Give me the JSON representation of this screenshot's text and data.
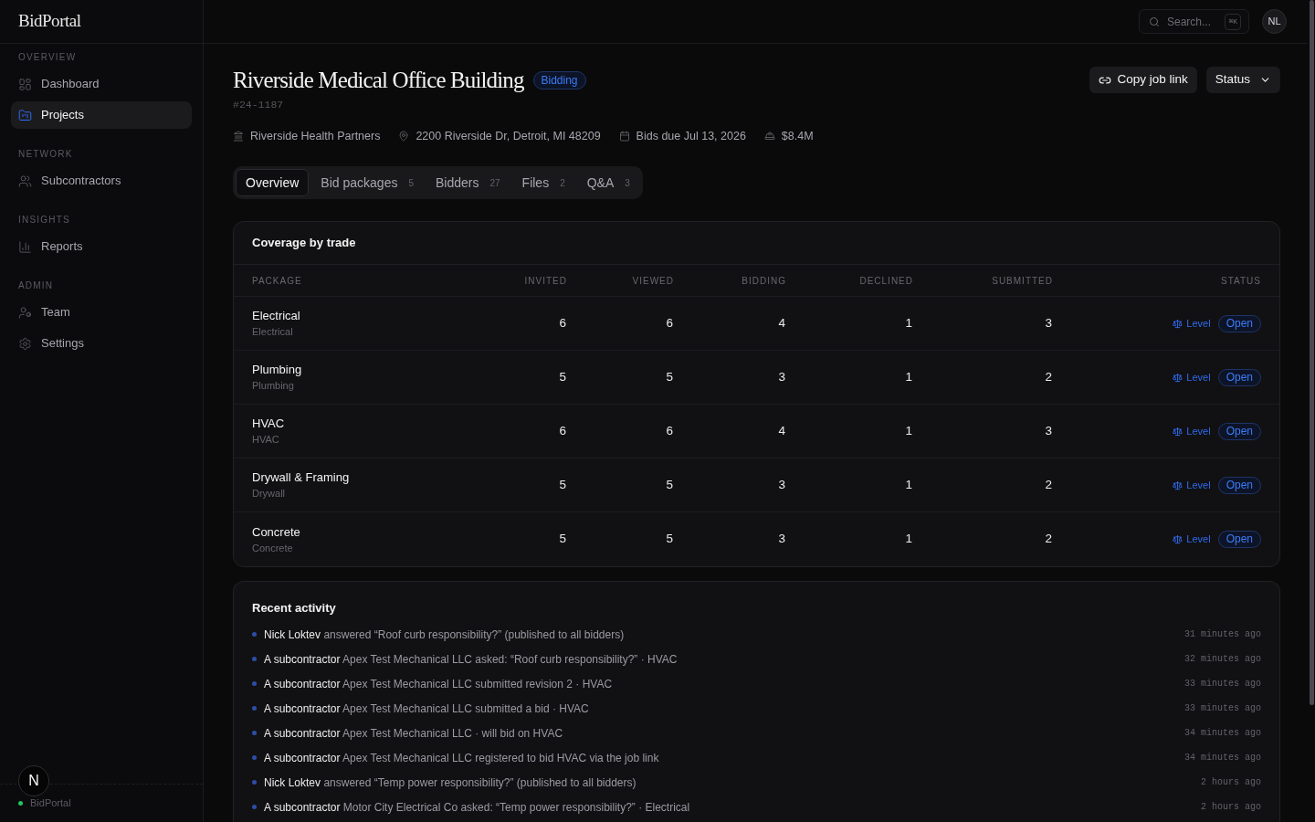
{
  "sidebar": {
    "logo": "BidPortal",
    "sections": [
      {
        "label": "OVERVIEW",
        "items": [
          {
            "label": "Dashboard",
            "selected": false
          },
          {
            "label": "Projects",
            "selected": true
          }
        ]
      },
      {
        "label": "NETWORK",
        "items": [
          {
            "label": "Subcontractors",
            "selected": false
          }
        ]
      },
      {
        "label": "INSIGHTS",
        "items": [
          {
            "label": "Reports",
            "selected": false
          }
        ]
      },
      {
        "label": "ADMIN",
        "items": [
          {
            "label": "Team",
            "selected": false
          },
          {
            "label": "Settings",
            "selected": false
          }
        ]
      }
    ],
    "footer": {
      "label": "BidPortal"
    }
  },
  "dev_badge": {
    "label": "N"
  },
  "top_bar": {
    "search": {
      "placeholder": "Search...",
      "shortcut": "⌘K"
    },
    "avatar": "NL"
  },
  "project": {
    "title": "Riverside Medical Office Building",
    "status": "Bidding",
    "number": "#24-1187",
    "meta": [
      "Riverside Health Partners",
      "2200 Riverside Dr, Detroit, MI 48209",
      "Bids due Jul 13, 2026",
      "$8.4M"
    ],
    "actions": [
      "Copy job link",
      "Status"
    ]
  },
  "tabs": [
    {
      "label": "Overview",
      "selected": true
    },
    {
      "label": "Bid packages",
      "count": "5",
      "selected": false
    },
    {
      "label": "Bidders",
      "count": "27",
      "selected": false
    },
    {
      "label": "Files",
      "count": "2",
      "selected": false
    },
    {
      "label": "Q&A",
      "count": "3",
      "selected": false
    }
  ],
  "coverage": {
    "title": "Coverage by trade",
    "columns": [
      "PACKAGE",
      "INVITED",
      "VIEWED",
      "BIDDING",
      "DECLINED",
      "SUBMITTED",
      "STATUS"
    ],
    "rows": [
      {
        "package": "Electrical",
        "trade": "Electrical",
        "invited": "6",
        "viewed": "6",
        "bidding": "4",
        "declined": "1",
        "submitted": "3",
        "action": "Level",
        "status": "Open"
      },
      {
        "package": "Plumbing",
        "trade": "Plumbing",
        "invited": "5",
        "viewed": "5",
        "bidding": "3",
        "declined": "1",
        "submitted": "2",
        "action": "Level",
        "status": "Open"
      },
      {
        "package": "HVAC",
        "trade": "HVAC",
        "invited": "6",
        "viewed": "6",
        "bidding": "4",
        "declined": "1",
        "submitted": "3",
        "action": "Level",
        "status": "Open"
      },
      {
        "package": "Drywall & Framing",
        "trade": "Drywall",
        "invited": "5",
        "viewed": "5",
        "bidding": "3",
        "declined": "1",
        "submitted": "2",
        "action": "Level",
        "status": "Open"
      },
      {
        "package": "Concrete",
        "trade": "Concrete",
        "invited": "5",
        "viewed": "5",
        "bidding": "3",
        "declined": "1",
        "submitted": "2",
        "action": "Level",
        "status": "Open"
      }
    ]
  },
  "activity": {
    "title": "Recent activity",
    "items": [
      {
        "actor": "Nick Loktev",
        "text": "answered “Roof curb responsibility?” (published to all bidders)",
        "time": "31 minutes ago"
      },
      {
        "actor": "A subcontractor",
        "text": "Apex Test Mechanical LLC asked: “Roof curb responsibility?” · HVAC",
        "time": "32 minutes ago"
      },
      {
        "actor": "A subcontractor",
        "text": "Apex Test Mechanical LLC submitted revision 2 · HVAC",
        "time": "33 minutes ago"
      },
      {
        "actor": "A subcontractor",
        "text": "Apex Test Mechanical LLC submitted a bid · HVAC",
        "time": "33 minutes ago"
      },
      {
        "actor": "A subcontractor",
        "text": "Apex Test Mechanical LLC · will bid on HVAC",
        "time": "34 minutes ago"
      },
      {
        "actor": "A subcontractor",
        "text": "Apex Test Mechanical LLC registered to bid HVAC via the job link",
        "time": "34 minutes ago"
      },
      {
        "actor": "Nick Loktev",
        "text": "answered “Temp power responsibility?” (published to all bidders)",
        "time": "2 hours ago"
      },
      {
        "actor": "A subcontractor",
        "text": "Motor City Electrical Co asked: “Temp power responsibility?” · Electrical",
        "time": "2 hours ago"
      }
    ]
  }
}
